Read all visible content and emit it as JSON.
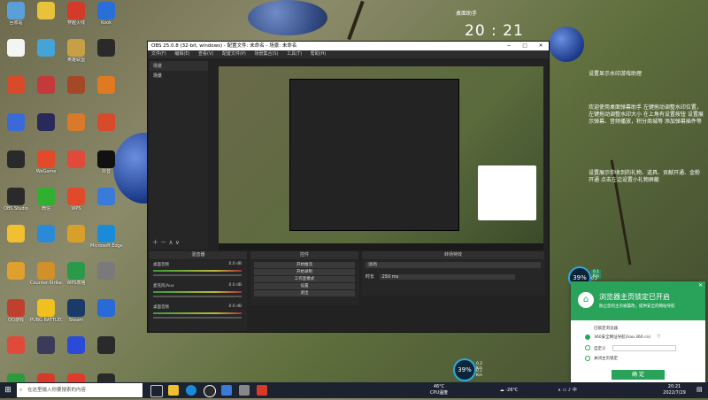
{
  "desktop": {
    "icons": [
      {
        "label": "回收站",
        "color": "#5aa0d8"
      },
      {
        "label": "",
        "color": "#e7c23a"
      },
      {
        "label": "穿越火线",
        "color": "#d33a2a"
      },
      {
        "label": "Kook",
        "color": "#2a6fd8"
      },
      {
        "label": "",
        "color": "#f4f4f4"
      },
      {
        "label": "",
        "color": "#44a4d8"
      },
      {
        "label": "英雄联盟",
        "color": "#c7a046"
      },
      {
        "label": "",
        "color": "#2a2a2a"
      },
      {
        "label": "",
        "color": "#d84a2a"
      },
      {
        "label": "",
        "color": "#c43a3a"
      },
      {
        "label": "",
        "color": "#a44828"
      },
      {
        "label": "",
        "color": "#e07a20"
      },
      {
        "label": "",
        "color": "#3a6ad8"
      },
      {
        "label": "",
        "color": "#2a2a5a"
      },
      {
        "label": "",
        "color": "#d87a2a"
      },
      {
        "label": "",
        "color": "#d84a2a"
      },
      {
        "label": "",
        "color": "#2a2a2a"
      },
      {
        "label": "WeGame",
        "color": "#e24a2a"
      },
      {
        "label": "",
        "color": "#e04a3a"
      },
      {
        "label": "抖音",
        "color": "#111111"
      },
      {
        "label": "OBS Studio",
        "color": "#2a2a2a"
      },
      {
        "label": "微信",
        "color": "#30b030"
      },
      {
        "label": "WPS",
        "color": "#e04a2a"
      },
      {
        "label": "",
        "color": "#3a7ad8"
      },
      {
        "label": "",
        "color": "#f0c030"
      },
      {
        "label": "",
        "color": "#2a8ad8"
      },
      {
        "label": "",
        "color": "#d8a02a"
      },
      {
        "label": "Microsoft Edge",
        "color": "#1b8ad8"
      },
      {
        "label": "",
        "color": "#e0a030"
      },
      {
        "label": "Counter-Strike Global...",
        "color": "#d0902a"
      },
      {
        "label": "WPS表格",
        "color": "#2a9a4a"
      },
      {
        "label": "",
        "color": "#7a7a7a"
      },
      {
        "label": "QQ游戏",
        "color": "#c04030"
      },
      {
        "label": "PUBG BATTLEGR...",
        "color": "#f0c020"
      },
      {
        "label": "Steam",
        "color": "#1a3a6a"
      },
      {
        "label": "",
        "color": "#2a6ad8"
      },
      {
        "label": "",
        "color": "#e04a3a"
      },
      {
        "label": "",
        "color": "#3a3a5a"
      },
      {
        "label": "",
        "color": "#2a4ad8"
      },
      {
        "label": "",
        "color": "#2a2a2a"
      },
      {
        "label": "",
        "color": "#2a9a3a"
      },
      {
        "label": "",
        "color": "#d83a2a"
      },
      {
        "label": "",
        "color": "#e03a2a"
      },
      {
        "label": "",
        "color": "#2a2a2a"
      }
    ]
  },
  "clock_widget": {
    "title": "桌面助手",
    "time": "20 : 21"
  },
  "notes": {
    "line1": "设置显示水印游戏助理",
    "block2": "欢迎使用桌面弹幕助手 左键拖动调整水印位置，左键拖动调整水印大小 在上角有设置按钮 设置展示弹幕、音频播放，积分商城等 添加弹幕插件等",
    "block3": "设置展示你收到的礼物、道具、贡献开通、金粉开通 点击左边设置小礼物屏蔽"
  },
  "obs": {
    "title": "OBS 25.0.8 (32-bit, windows) - 配置文件: 未命名 - 场景: 未命名",
    "menu": [
      "文件(F)",
      "编辑(E)",
      "查看(V)",
      "配置文件(P)",
      "场景集合(S)",
      "工具(T)",
      "帮助(H)"
    ],
    "scenes_header": "场景",
    "scene_item": "场景",
    "mixer_header": "混音器",
    "controls_header": "控件",
    "transition_header": "转场特效",
    "channels": [
      {
        "name": "桌面音频",
        "db": "0.0 dB"
      },
      {
        "name": "麦克风/Aux",
        "db": "0.0 dB"
      },
      {
        "name": "桌面音频",
        "db": "0.0 dB"
      }
    ],
    "controls": [
      "开始推流",
      "开始录制",
      "工作室模式",
      "设置",
      "退出"
    ],
    "transition": {
      "type": "淡出",
      "duration_label": "时长",
      "duration": "250 ms"
    }
  },
  "cpu_widget": {
    "value": "39%",
    "line1": "0.1 K/s",
    "line2": "0.2 K/s"
  },
  "cpu_widget2": {
    "value": "39%",
    "line1": "0.2 K/s",
    "line2": "0.1 K/s"
  },
  "lock_popup": {
    "title": "浏览器主页锁定已开启",
    "subtitle": "防止您的主页被篡改，提供安全的网站导航",
    "label": "已锁定浏览器",
    "options": [
      "360安全网址导航(hao.360.cn)",
      "自定义",
      "",
      "关闭主页锁定"
    ],
    "ok": "确 定"
  },
  "taskbar": {
    "search_placeholder": "在这里输入你要搜索的内容",
    "weather": "-26°C",
    "cpu": "CPU温度",
    "temp": "46°C",
    "time": "20:21",
    "date": "2022/7/29",
    "lang": "中"
  }
}
